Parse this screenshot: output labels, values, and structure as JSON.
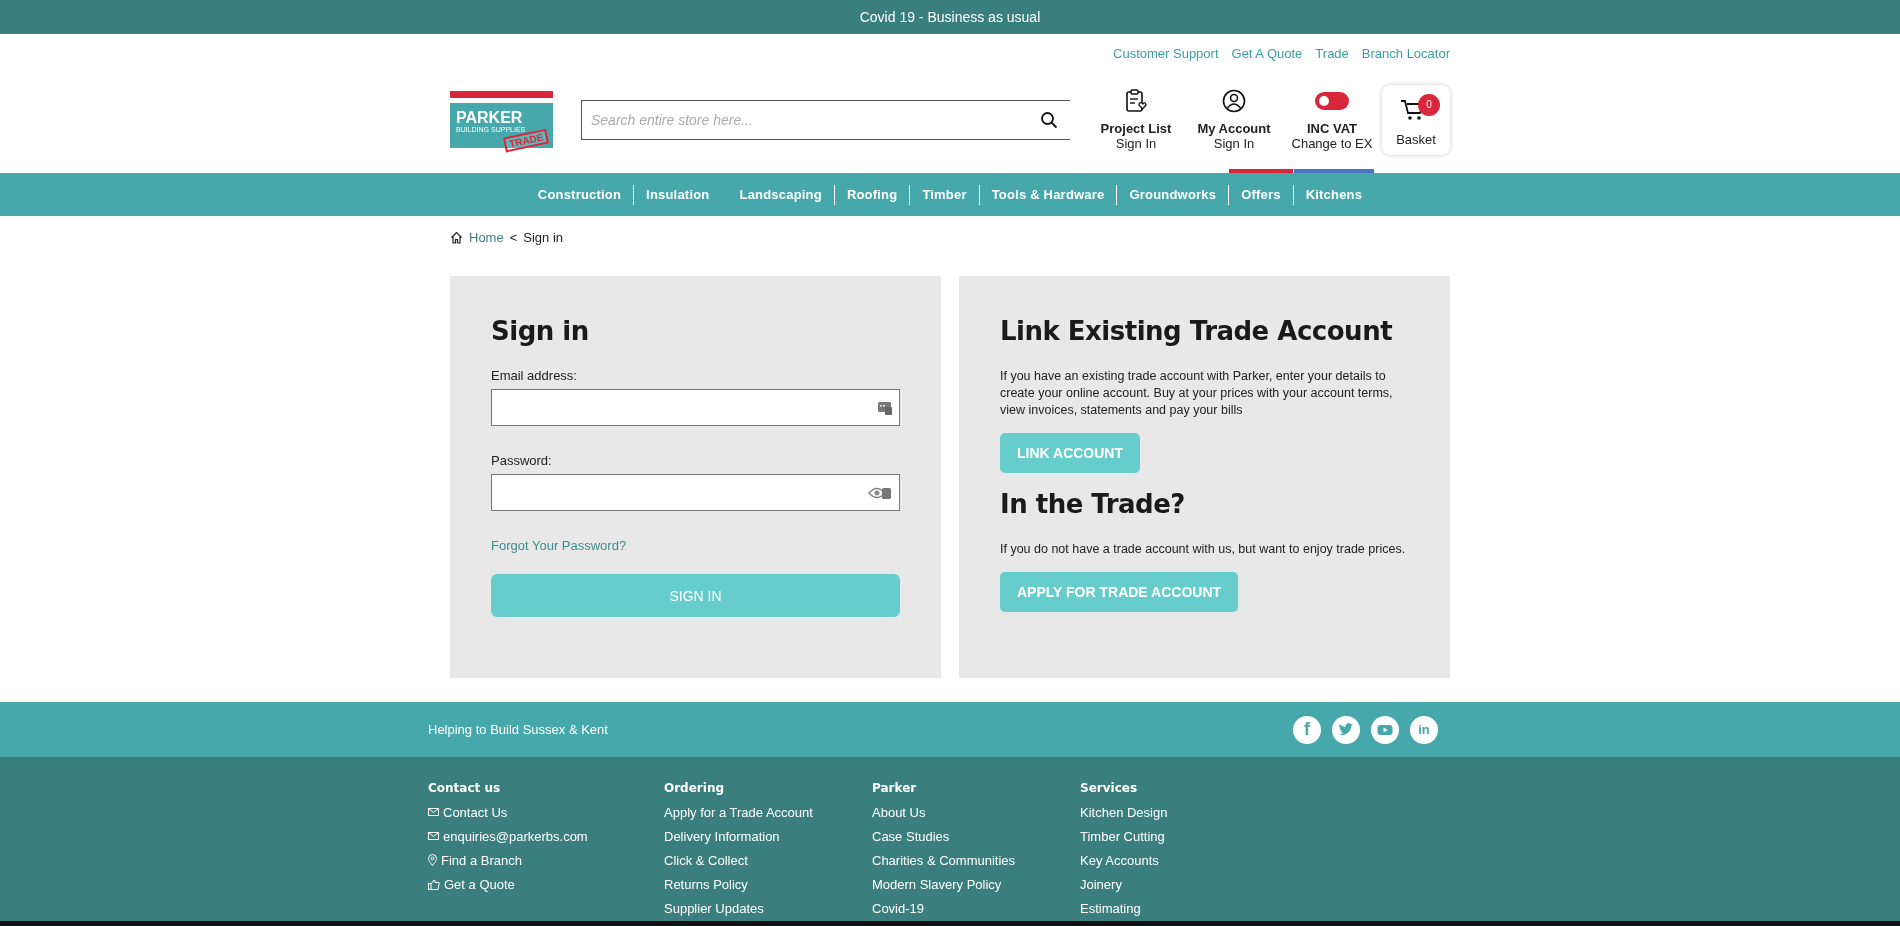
{
  "announcement": "Covid 19 - Business as usual",
  "top_links": [
    "Customer Support",
    "Get A Quote",
    "Trade",
    "Branch Locator"
  ],
  "logo": {
    "name": "PARKER",
    "tagline": "BUILDING SUPPLIES",
    "stamp": "TRADE"
  },
  "search": {
    "placeholder": "Search entire store here..."
  },
  "header_actions": [
    {
      "kind": "project",
      "title": "Project List",
      "subtitle": "Sign In"
    },
    {
      "kind": "account",
      "title": "My Account",
      "subtitle": "Sign In"
    },
    {
      "kind": "vat",
      "title": "INC VAT",
      "subtitle": "Change to EX",
      "on": false
    }
  ],
  "basket": {
    "label": "Basket",
    "count": "0"
  },
  "nav": [
    {
      "label": "Construction"
    },
    {
      "label": "Insulation"
    },
    {
      "label": "Landscaping"
    },
    {
      "label": "Roofing"
    },
    {
      "label": "Timber"
    },
    {
      "label": "Tools & Hardware"
    },
    {
      "label": "Groundworks"
    },
    {
      "label": "Offers",
      "color": "#d9263a"
    },
    {
      "label": "Kitchens",
      "color": "#4a78c4"
    }
  ],
  "breadcrumb": [
    {
      "label": "Home",
      "kind": "link"
    },
    {
      "label": "<",
      "kind": "separator"
    },
    {
      "label": "Sign in",
      "kind": "current"
    }
  ],
  "sign_in": {
    "title": "Sign in",
    "fields": [
      {
        "label": "Email address:",
        "kind": "email"
      },
      {
        "label": "Password:",
        "kind": "password"
      }
    ],
    "forgot": "Forgot Your Password?",
    "button": "SIGN IN"
  },
  "link_account": {
    "title": "Link Existing Trade Account",
    "text": "If you have an existing trade account with Parker, enter your details to create your online account. Buy at your prices with your account terms, view invoices, statements and pay your bills",
    "button": "LINK ACCOUNT"
  },
  "trade": {
    "title": "In the Trade?",
    "text": "If you do not have a trade account with us, but want to enjoy trade prices.",
    "button": "APPLY FOR TRADE ACCOUNT"
  },
  "footer": {
    "tagline": "Helping to Build Sussex & Kent",
    "social": [
      {
        "kind": "facebook",
        "glyph": "f"
      },
      {
        "kind": "twitter"
      },
      {
        "kind": "youtube"
      },
      {
        "kind": "linkedin",
        "glyph": "in"
      }
    ],
    "columns": [
      {
        "heading": "Contact us",
        "links": [
          {
            "label": "Contact Us",
            "kind": "mail"
          },
          {
            "label": "enquiries@parkerbs.com",
            "kind": "mail"
          },
          {
            "label": "Find a Branch",
            "kind": "pin"
          },
          {
            "label": "Get a Quote",
            "kind": "thumb"
          }
        ]
      },
      {
        "heading": "Ordering",
        "links": [
          {
            "label": "Apply for a Trade Account"
          },
          {
            "label": "Delivery Information"
          },
          {
            "label": "Click & Collect"
          },
          {
            "label": "Returns Policy"
          },
          {
            "label": "Supplier Updates"
          }
        ]
      },
      {
        "heading": "Parker",
        "links": [
          {
            "label": "About Us"
          },
          {
            "label": "Case Studies"
          },
          {
            "label": "Charities & Communities"
          },
          {
            "label": "Modern Slavery Policy"
          },
          {
            "label": "Covid-19"
          }
        ]
      },
      {
        "heading": "Services",
        "links": [
          {
            "label": "Kitchen Design"
          },
          {
            "label": "Timber Cutting"
          },
          {
            "label": "Key Accounts"
          },
          {
            "label": "Joinery"
          },
          {
            "label": "Estimating"
          }
        ]
      }
    ]
  }
}
